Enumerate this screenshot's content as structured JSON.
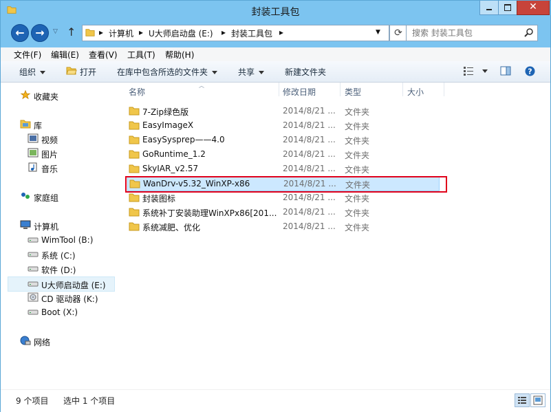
{
  "window": {
    "title": "封装工具包"
  },
  "nav": {
    "breadcrumbs": [
      "计算机",
      "U大师启动盘 (E:)",
      "封装工具包"
    ],
    "search_placeholder": "搜索 封装工具包"
  },
  "menu": [
    "文件(F)",
    "编辑(E)",
    "查看(V)",
    "工具(T)",
    "帮助(H)"
  ],
  "toolbar": {
    "organize": "组织",
    "open": "打开",
    "include_library": "在库中包含所选的文件夹",
    "share": "共享",
    "new_folder": "新建文件夹"
  },
  "nav_pane": {
    "favorites": "收藏夹",
    "libraries": "库",
    "library_items": [
      "视频",
      "图片",
      "音乐"
    ],
    "homegroup": "家庭组",
    "computer": "计算机",
    "drives": [
      "WimTool (B:)",
      "系统 (C:)",
      "软件 (D:)",
      "U大师启动盘 (E:)",
      "CD 驱动器 (K:)",
      "Boot (X:)"
    ],
    "network": "网络"
  },
  "columns": {
    "name": "名称",
    "modified": "修改日期",
    "type": "类型",
    "size": "大小"
  },
  "files": [
    {
      "name": "7-Zip绿色版",
      "date": "2014/8/21 ...",
      "type": "文件夹"
    },
    {
      "name": "EasyImageX",
      "date": "2014/8/21 ...",
      "type": "文件夹"
    },
    {
      "name": "EasySysprep——4.0",
      "date": "2014/8/21 ...",
      "type": "文件夹"
    },
    {
      "name": "GoRuntime_1.2",
      "date": "2014/8/21 ...",
      "type": "文件夹"
    },
    {
      "name": "SkyIAR_v2.57",
      "date": "2014/8/21 ...",
      "type": "文件夹"
    },
    {
      "name": "WanDrv-v5.32_WinXP-x86",
      "date": "2014/8/21 ...",
      "type": "文件夹"
    },
    {
      "name": "封装图标",
      "date": "2014/8/21 ...",
      "type": "文件夹"
    },
    {
      "name": "系统补丁安装助理WinXPx86[201...",
      "date": "2014/8/21 ...",
      "type": "文件夹"
    },
    {
      "name": "系统减肥、优化",
      "date": "2014/8/21 ...",
      "type": "文件夹"
    }
  ],
  "status": {
    "item_count": "9 个项目",
    "selected": "选中 1 个项目"
  },
  "colors": {
    "accent": "#7cc4f0",
    "selection": "#cce8ff",
    "highlight_border": "#e0001a",
    "folder": "#f0c64a"
  }
}
